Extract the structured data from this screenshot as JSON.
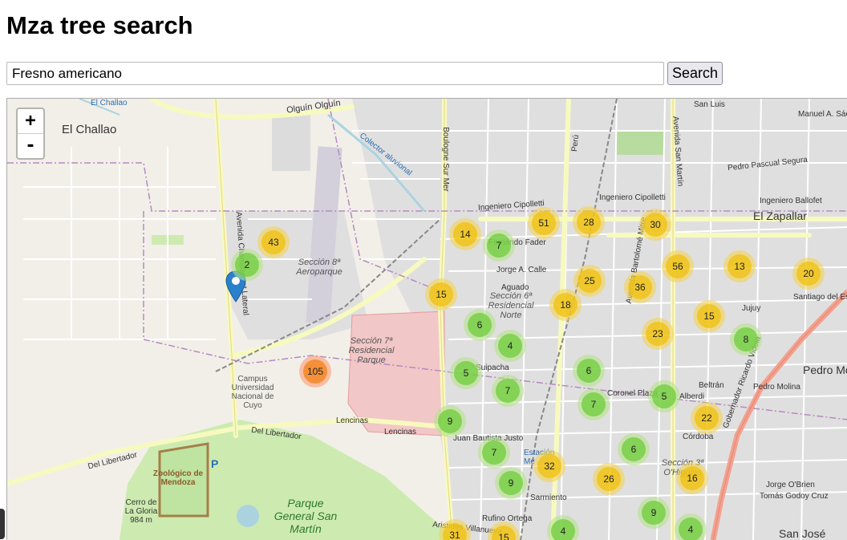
{
  "page": {
    "title": "Mza tree search"
  },
  "search": {
    "value": "Fresno americano",
    "button_label": "Search"
  },
  "map": {
    "zoom_in_label": "+",
    "zoom_out_label": "-",
    "clusters": [
      {
        "count": "43",
        "size": "medium"
      },
      {
        "count": "2",
        "size": "small"
      },
      {
        "count": "14",
        "size": "medium"
      },
      {
        "count": "7",
        "size": "small"
      },
      {
        "count": "51",
        "size": "medium"
      },
      {
        "count": "28",
        "size": "medium"
      },
      {
        "count": "30",
        "size": "medium"
      },
      {
        "count": "56",
        "size": "medium"
      },
      {
        "count": "13",
        "size": "medium"
      },
      {
        "count": "20",
        "size": "medium"
      },
      {
        "count": "15",
        "size": "medium"
      },
      {
        "count": "25",
        "size": "medium"
      },
      {
        "count": "36",
        "size": "medium"
      },
      {
        "count": "18",
        "size": "medium"
      },
      {
        "count": "15",
        "size": "medium"
      },
      {
        "count": "8",
        "size": "small"
      },
      {
        "count": "6",
        "size": "small"
      },
      {
        "count": "23",
        "size": "medium"
      },
      {
        "count": "4",
        "size": "small"
      },
      {
        "count": "105",
        "size": "large"
      },
      {
        "count": "5",
        "size": "small"
      },
      {
        "count": "6",
        "size": "small"
      },
      {
        "count": "7",
        "size": "small"
      },
      {
        "count": "7",
        "size": "small"
      },
      {
        "count": "5",
        "size": "small"
      },
      {
        "count": "22",
        "size": "medium"
      },
      {
        "count": "9",
        "size": "small"
      },
      {
        "count": "6",
        "size": "small"
      },
      {
        "count": "7",
        "size": "small"
      },
      {
        "count": "32",
        "size": "medium"
      },
      {
        "count": "26",
        "size": "medium"
      },
      {
        "count": "16",
        "size": "medium"
      },
      {
        "count": "9",
        "size": "small"
      },
      {
        "count": "9",
        "size": "small"
      },
      {
        "count": "4",
        "size": "small"
      },
      {
        "count": "4",
        "size": "small"
      },
      {
        "count": "31",
        "size": "medium"
      },
      {
        "count": "15",
        "size": "medium"
      }
    ],
    "labels": {
      "el_challao_small": "El Challao",
      "el_challao": "El Challao",
      "olguin": "Olguín Olguín",
      "colector": "Colector aluvional",
      "boulogne": "Boulogne Sur Mer",
      "peru": "Perú",
      "san_luis": "San Luis",
      "manuel_a": "Manuel A. Sáez",
      "pedro_pascual": "Pedro Pascual Segura",
      "ing_cipolletti_1": "Ingeniero Cipolletti",
      "ing_cipolletti_2": "Ingeniero Cipolletti",
      "ing_ballofet": "Ingeniero Ballofet",
      "el_zapallar": "El Zapallar",
      "fader": "Fernando Fader",
      "jorge_calle": "Jorge A. Calle",
      "aguado": "Aguado",
      "seccion_aero": "Sección 8ª Aeroparque",
      "seccion_norte": "Sección 6ª Residencial Norte",
      "seccion_parque": "Sección 7ª Residencial Parque",
      "santiago": "Santiago del Estero",
      "jujuy": "Jujuy",
      "pedro_molina": "Pedro Molina",
      "pedro_m": "Pedro Mo",
      "coronel_plaza": "Coronel Plaza",
      "alberdi": "Alberdi",
      "beltran": "Beltrán",
      "cordoba": "Córdoba",
      "suipacha": "Suipacha",
      "lencinas_1": "Lencinas",
      "lencinas_2": "Lencinas",
      "del_libertador_1": "Del Libertador",
      "del_libertador_2": "Del Libertador",
      "juan_bautista": "Juan Bautista Justo",
      "estacion": "Estación Me",
      "sarmiento": "Sarmiento",
      "rufino": "Rufino Ortega",
      "aristides": "Aristides Villanueva",
      "seccion_ohiggins": "Sección 3ª O'Higgins",
      "jorge_obrien": "Jorge O'Brien",
      "tomas_godoy": "Tomás Godoy Cruz",
      "san_jose": "San José",
      "campus": "Campus Universidad Nacional de Cuyo",
      "zoologico": "Zoológico de Mendoza",
      "cerro": "Cerro de La Gloria 984 m",
      "parque": "Parque General San Martín",
      "parking": "P",
      "avenida_champagnat": "Avenida Champagnat Lateral",
      "gobernador": "Gobernador Ricardo Videla",
      "bartolome": "Avenida Bartolomé Mitre",
      "avenida_san_martin": "Avenida San Martín"
    }
  }
}
